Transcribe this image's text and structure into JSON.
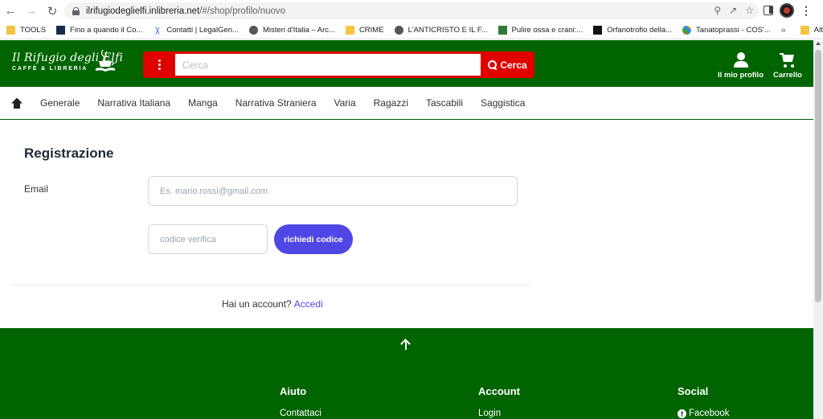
{
  "browser": {
    "url_host": "ilrifugiodeglielfi.inlibreria.net",
    "url_path": "/#/shop/profilo/nuovo",
    "bookmarks": [
      {
        "label": "TOOLS",
        "icon": "folder-icon"
      },
      {
        "label": "Fino a quando il Co...",
        "icon": "page-icon"
      },
      {
        "label": "Contatti | LegalGen...",
        "icon": "legal-icon"
      },
      {
        "label": "Misteri d'Italia – Arc...",
        "icon": "globe-icon"
      },
      {
        "label": "CRIME",
        "icon": "folder-icon"
      },
      {
        "label": "L'ANTICRISTO E IL F...",
        "icon": "globe-icon"
      },
      {
        "label": "Pulire ossa e crani:...",
        "icon": "bone-icon"
      },
      {
        "label": "Orfanotrofio della...",
        "icon": "page-icon"
      },
      {
        "label": "Tanatoprassi - COS'...",
        "icon": "joomla-icon"
      }
    ],
    "more_bookmarks": "»",
    "other_favorites": "Altri Preferiti"
  },
  "header": {
    "logo_title": "Il Rifugio degli Elfi",
    "logo_subtitle": "CAFFÈ & LIBRERIA",
    "search_placeholder": "Cerca",
    "search_button": "Cerca",
    "profile_label": "Il mio profilo",
    "cart_label": "Carrello"
  },
  "categories": [
    "Generale",
    "Narrativa Italiana",
    "Manga",
    "Narrativa Straniera",
    "Varia",
    "Ragazzi",
    "Tascabili",
    "Saggistica"
  ],
  "form": {
    "title": "Registrazione",
    "email_label": "Email",
    "email_placeholder": "Es. mario.rossi@gmail.com",
    "code_placeholder": "codice verifica",
    "code_button": "richiedi codice",
    "have_account": "Hai un account?",
    "login_link": "Accedi"
  },
  "footer": {
    "columns": [
      {
        "title": "Aiuto",
        "link": "Contattaci"
      },
      {
        "title": "Account",
        "link": "Login"
      },
      {
        "title": "Social",
        "link": "Facebook"
      }
    ]
  }
}
